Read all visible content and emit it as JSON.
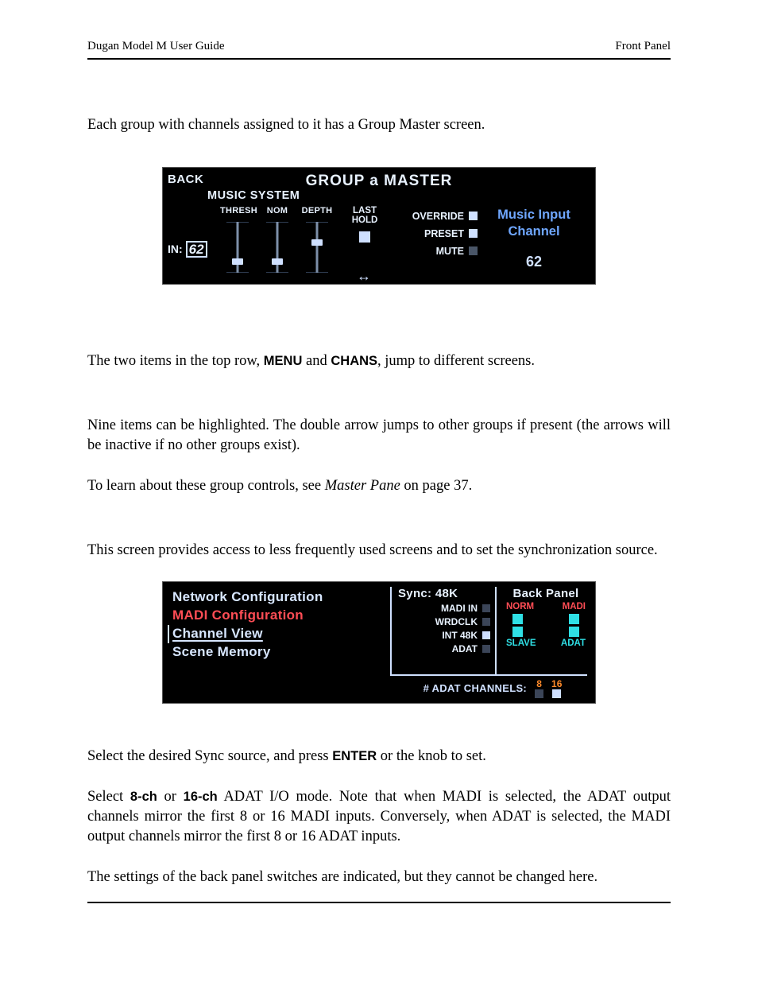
{
  "header": {
    "left": "Dugan Model M User Guide",
    "right": "Front Panel"
  },
  "para": {
    "p1": "Each group with channels assigned to it has a Group Master screen.",
    "p2a": "The two items in the top row, ",
    "p2_menu": "MENU",
    "p2b": " and ",
    "p2_chans": "CHANS",
    "p2c": ", jump to different screens.",
    "p3": "Nine items can be highlighted. The double arrow jumps to other groups if present (the arrows will be inactive if no other groups exist).",
    "p4a": "To learn about these group controls, see ",
    "p4_em": "Master Pane",
    "p4b": " on page 37.",
    "p5": "This screen provides access to less frequently used screens and to set the synchronization source.",
    "p6a": "Select the desired Sync source, and press ",
    "p6_enter": "ENTER",
    "p6b": " or the knob to set.",
    "p7a": "Select ",
    "p7_8": "8-ch",
    "p7b": " or ",
    "p7_16": "16-ch",
    "p7c": " ADAT I/O mode. Note that when MADI is selected, the ADAT output channels mirror the first 8 or 16 MADI inputs. Conversely, when ADAT is selected, the MADI output channels mirror the first 8 or 16 ADAT inputs.",
    "p8": "The settings of the back panel switches are indicated, but they cannot be changed here."
  },
  "shot1": {
    "back": "BACK",
    "title": "GROUP a MASTER",
    "subtitle": "MUSIC SYSTEM",
    "in_label": "IN:",
    "in_value": "62",
    "cols": {
      "thresh": "THRESH",
      "nom": "NOM",
      "depth": "DEPTH"
    },
    "last": "LAST",
    "hold": "HOLD",
    "override": "OVERRIDE",
    "preset": "PRESET",
    "mute": "MUTE",
    "arrows": "↔",
    "music1": "Music Input",
    "music2": "Channel",
    "music3": "62"
  },
  "shot2": {
    "left_items": {
      "net": "Network Configuration",
      "madi": "MADI Configuration",
      "chan": "Channel View",
      "scene": "Scene Memory"
    },
    "sync_title": "Sync: 48K",
    "sync_opts": {
      "madi_in": "MADI IN",
      "wrdclk": "WRDCLK",
      "int48k": "INT 48K",
      "adat": "ADAT"
    },
    "back_title": "Back Panel",
    "back_hdr": {
      "norm": "NORM",
      "madi": "MADI"
    },
    "back_ftr": {
      "slave": "SLAVE",
      "adat": "ADAT"
    },
    "adat_label": "# ADAT CHANNELS:",
    "adat_opts": {
      "n8": "8",
      "n16": "16"
    }
  }
}
